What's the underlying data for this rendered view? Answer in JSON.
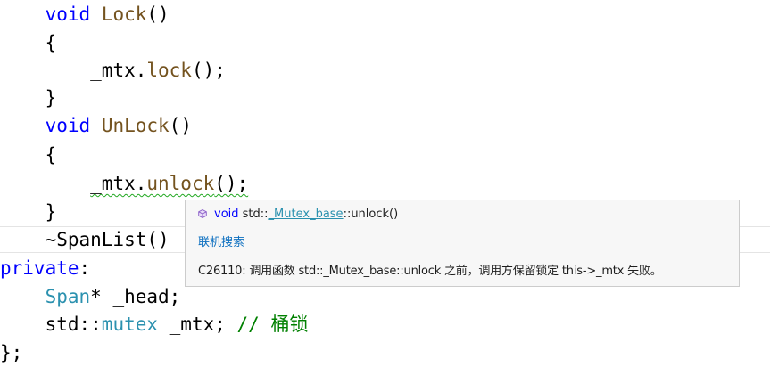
{
  "code": {
    "l1": {
      "kw": "void",
      "fn": "Lock",
      "rest": "()"
    },
    "l2": {
      "text": "{"
    },
    "l3": {
      "var": "_mtx.",
      "fn": "lock",
      "rest": "();"
    },
    "l4": {
      "text": "}"
    },
    "l5": {
      "kw": "void",
      "fn": "UnLock",
      "rest": "()"
    },
    "l6": {
      "text": "{"
    },
    "l7": {
      "var": "_mtx.",
      "fn": "unlock",
      "rest": "();"
    },
    "l8": {
      "text": "}"
    },
    "l9": {
      "text": "~SpanList()"
    },
    "l10": {
      "kw": "private",
      "rest": ":"
    },
    "l11": {
      "ty": "Span",
      "rest": "* _head;"
    },
    "l12": {
      "ns": "std::",
      "ty": "mutex",
      "rest": " _mtx;",
      "cm": "// 桶锁"
    },
    "l13": {
      "text": "};"
    }
  },
  "quickinfo": {
    "icon": "method-cube-icon",
    "sig_kw": "void",
    "sig_ns": "std::",
    "sig_type": "_Mutex_base",
    "sig_rest": "::unlock()",
    "search_link": "联机搜索",
    "message": "C26110: 调用函数 std::_Mutex_base::unlock 之前，调用方保留锁定 this->_mtx 失败。"
  },
  "colors": {
    "keyword": "#0000ff",
    "function": "#74531f",
    "type": "#2b91af",
    "comment": "#008000",
    "squiggle": "#22a822"
  }
}
